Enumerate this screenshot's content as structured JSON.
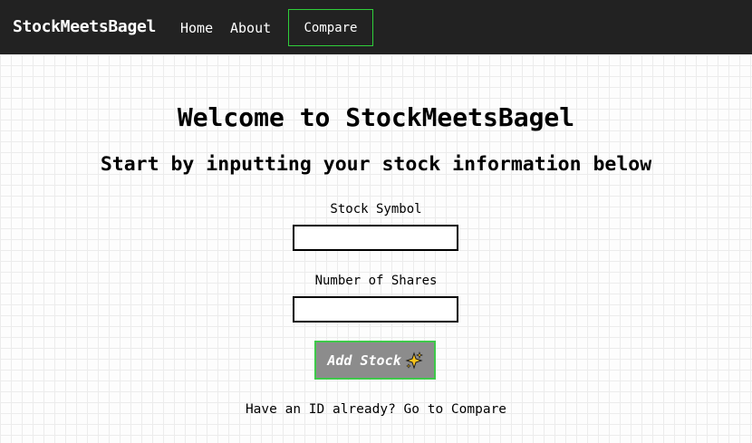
{
  "navbar": {
    "brand": "StockMeetsBagel",
    "links": [
      {
        "label": "Home"
      },
      {
        "label": "About"
      },
      {
        "label": "Compare"
      }
    ],
    "accent_color": "#2fcf3a",
    "background": "#222222"
  },
  "main": {
    "title": "Welcome to StockMeetsBagel",
    "subtitle": "Start by inputting your stock information below",
    "form": {
      "symbol_label": "Stock Symbol",
      "symbol_value": "",
      "shares_label": "Number of Shares",
      "shares_value": "",
      "submit_label": "Add Stock",
      "submit_icon": "sparkles-icon"
    },
    "footer": {
      "prompt": "Have an ID already?",
      "link": "Go to Compare"
    }
  }
}
